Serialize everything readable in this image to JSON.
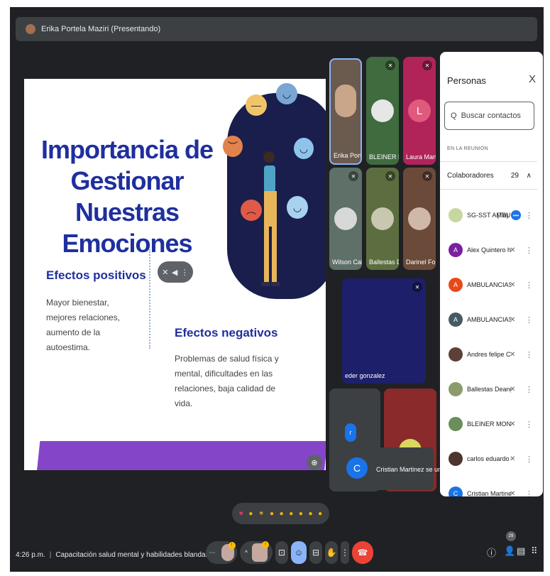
{
  "presenter": {
    "label": "Erika Portela Maziri (Presentando)"
  },
  "slide": {
    "title_line1": "Importancia de Gestionar",
    "title_line2": "Nuestras Emociones",
    "positive": {
      "heading": "Efectos positivos",
      "text": "Mayor bienestar, mejores relaciones, aumento de la autoestima."
    },
    "negative": {
      "heading": "Efectos negativos",
      "text": "Problemas de salud física y mental, dificultades en las relaciones, baja calidad de vida."
    }
  },
  "tiles": [
    {
      "name": "Erika Portela ...",
      "color": "#6b5a4e"
    },
    {
      "name": "BLEINER MON...",
      "color": "#3f6b3f"
    },
    {
      "name": "Laura Martine...",
      "color": "#b0245a",
      "letter": "L"
    },
    {
      "name": "Wilson Calle",
      "color": "#5e7068"
    },
    {
      "name": "Ballestas Dea...",
      "color": "#5c6e40"
    },
    {
      "name": "Darinel Forelo",
      "color": "#6b4a3a"
    },
    {
      "name": "eder gonzalez",
      "color": "#1e1f6b"
    },
    {
      "name": "",
      "color": "#3c4043",
      "letter": "r"
    },
    {
      "name": "",
      "color": "#8a2a2a"
    }
  ],
  "people_panel": {
    "title": "Personas",
    "close_glyph": "X",
    "search_placeholder": "Buscar contactos",
    "section_label": "EN LA REUNIÓN",
    "group_label": "Colaboradores",
    "group_count": "29",
    "you_suffix": "(Tú)",
    "participants": [
      {
        "name": "SG-SST AMBULAN...",
        "avatar_color": "#c8d6a0",
        "letter": ""
      },
      {
        "name": "Alex Quintero herrera",
        "avatar_color": "#7b1fa2",
        "letter": "A"
      },
      {
        "name": "AMBULANCIAS PROYE...",
        "avatar_color": "#e64a19",
        "letter": "A"
      },
      {
        "name": "AMBULANCIAS PROYE...",
        "avatar_color": "#455a64",
        "letter": "A"
      },
      {
        "name": "Andres felipe Cortes",
        "avatar_color": "#5d4037",
        "letter": ""
      },
      {
        "name": "Ballestas Deangel",
        "avatar_color": "#8d9b6a",
        "letter": ""
      },
      {
        "name": "BLEINER MONSALVO BA",
        "avatar_color": "#6a8f5a",
        "letter": ""
      },
      {
        "name": "carlos eduardo araujo ...",
        "avatar_color": "#4e342e",
        "letter": ""
      },
      {
        "name": "Cristian Martinez",
        "avatar_color": "#1a73e8",
        "letter": "C"
      }
    ]
  },
  "toast": {
    "letter": "C",
    "text": "Cristian Martinez se unió"
  },
  "meeting": {
    "time": "4:26 p.m.",
    "title": "Capacitación salud mental y habilidades blandas-Pr..."
  },
  "people_count": "29",
  "badges": {
    "mic": "!",
    "cam": "!"
  }
}
